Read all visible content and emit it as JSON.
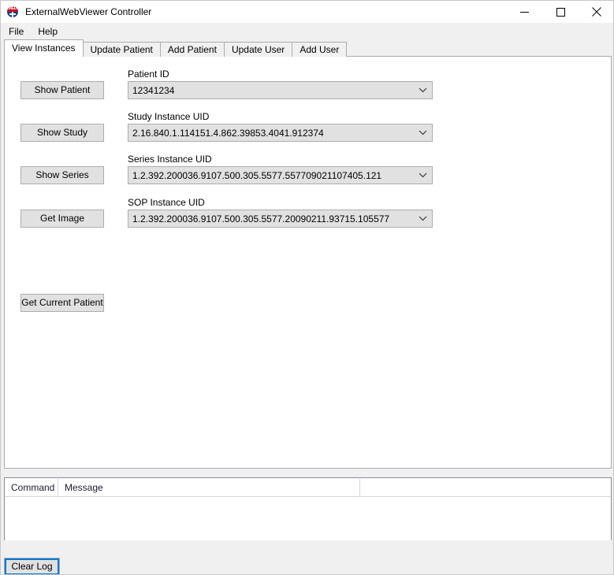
{
  "window": {
    "title": "ExternalWebViewer Controller",
    "icon": "med-badge-icon",
    "icon_text": "MED",
    "controls": {
      "minimize": "minimize-icon",
      "maximize": "maximize-icon",
      "close": "close-icon"
    }
  },
  "menu": {
    "items": [
      {
        "label": "File"
      },
      {
        "label": "Help"
      }
    ]
  },
  "tabs": [
    {
      "label": "View Instances",
      "selected": true
    },
    {
      "label": "Update Patient",
      "selected": false
    },
    {
      "label": "Add Patient",
      "selected": false
    },
    {
      "label": "Update User",
      "selected": false
    },
    {
      "label": "Add User",
      "selected": false
    }
  ],
  "view_instances": {
    "rows": [
      {
        "button_label": "Show Patient",
        "field_label": "Patient ID",
        "field_value": "12341234"
      },
      {
        "button_label": "Show Study",
        "field_label": "Study Instance UID",
        "field_value": "2.16.840.1.114151.4.862.39853.4041.912374"
      },
      {
        "button_label": "Show Series",
        "field_label": "Series Instance UID",
        "field_value": "1.2.392.200036.9107.500.305.5577.557709021107405.121"
      },
      {
        "button_label": "Get Image",
        "field_label": "SOP Instance UID",
        "field_value": "1.2.392.200036.9107.500.305.5577.20090211.93715.105577"
      }
    ],
    "get_current_patient_label": "Get Current Patient"
  },
  "log": {
    "columns": [
      {
        "label": "Command"
      },
      {
        "label": "Message"
      },
      {
        "label": ""
      }
    ],
    "rows": []
  },
  "footer": {
    "clear_log_label": "Clear Log"
  },
  "colors": {
    "window_background": "#f0f0f0",
    "panel_background": "#ffffff",
    "control_face": "#e1e1e1",
    "control_border": "#adadad",
    "focus_accent": "#0078d7",
    "icon_red": "#c1121f",
    "icon_blue": "#1d3f8f"
  }
}
